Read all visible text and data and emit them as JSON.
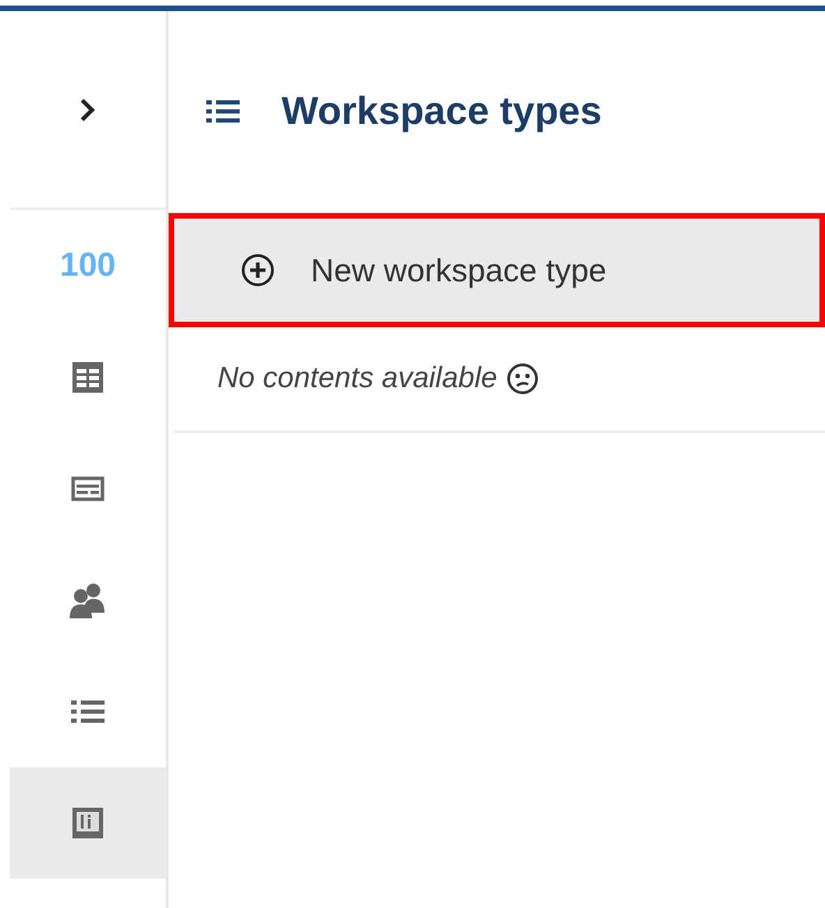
{
  "sidebar": {
    "items": [
      {
        "kind": "count",
        "label": "100",
        "selected": false
      },
      {
        "kind": "table",
        "selected": false
      },
      {
        "kind": "card",
        "selected": false
      },
      {
        "kind": "people",
        "selected": false
      },
      {
        "kind": "list",
        "selected": false
      },
      {
        "kind": "panel",
        "selected": true
      }
    ]
  },
  "header": {
    "title": "Workspace types"
  },
  "new_button": {
    "label": "New workspace type",
    "highlighted": true
  },
  "empty_message": "No contents available"
}
